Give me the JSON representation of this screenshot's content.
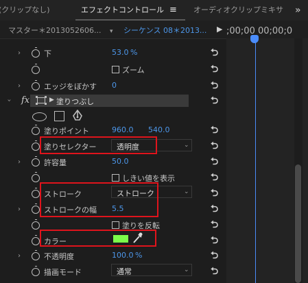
{
  "tabs": {
    "clip": "(クリップなし)",
    "effect_controls": "エフェクトコントロール",
    "menu": "≡",
    "audio_mixer": "オーディオクリップミキサ",
    "overflow": "»"
  },
  "header": {
    "master": "マスター＊2013052606...",
    "sequence": "シーケンス 08＊2013...",
    "play": "▶",
    "timecode": ";00;00  00;00;0"
  },
  "rows": {
    "down_label": "下",
    "down_value": "53.0",
    "down_unit": "%",
    "zoom_label": "ズーム",
    "edge_label": "エッジをぼかす",
    "edge_value": "0",
    "fx": "fx",
    "effect_name": "塗りつぶし",
    "fill_point_label": "塗りポイント",
    "fill_point_x": "960.0",
    "fill_point_y": "540.0",
    "fill_selector_label": "塗りセレクター",
    "fill_selector_value": "透明度",
    "tolerance_label": "許容量",
    "tolerance_value": "50.0",
    "threshold_label": "しきい値を表示",
    "stroke_label": "ストローク",
    "stroke_value": "ストローク",
    "stroke_width_label": "ストロークの幅",
    "stroke_width_value": "5.5",
    "invert_label": "塗りを反転",
    "color_label": "カラー",
    "color_swatch": "#7cfb4a",
    "opacity_label": "不透明度",
    "opacity_value": "100.0",
    "opacity_unit": "%",
    "blend_label": "描画モード",
    "blend_value": "通常",
    "reset_glyph": "⮌"
  },
  "colors": {
    "accent_blue": "#4d97ea",
    "highlight_red": "#e0141c",
    "playhead": "#4b8dfc"
  }
}
